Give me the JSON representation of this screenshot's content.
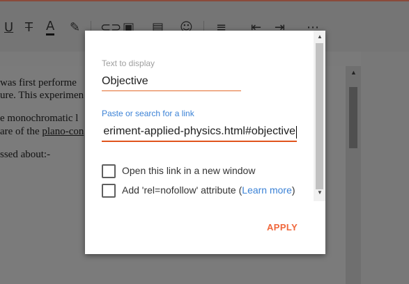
{
  "document": {
    "lines": [
      {
        "pre": "was first performe",
        "u": "",
        "post": ""
      },
      {
        "pre": "ure. This experimen",
        "u": "",
        "post": ""
      },
      {
        "pre": "e monochromatic l",
        "u": "",
        "post": ""
      },
      {
        "pre": "are of the ",
        "u": "plano-con",
        "post": ""
      },
      {
        "pre": "ssed about:-",
        "u": "",
        "post": ""
      }
    ]
  },
  "toolbar": {
    "icons": [
      "underline-icon",
      "strikethrough-icon",
      "text-color-icon",
      "highlight-icon",
      "link-icon",
      "image-icon",
      "video-icon",
      "emoji-icon",
      "align-icon",
      "indent-decrease-icon",
      "indent-increase-icon",
      "more-icon"
    ]
  },
  "link_dialog": {
    "text_label": "Text to display",
    "text_value": "Objective",
    "url_label": "Paste or search for a link",
    "url_value": "eriment-applied-physics.html#objective",
    "new_window_label": "Open this link in a new window",
    "nofollow_label_pre": "Add 'rel=nofollow' attribute (",
    "nofollow_link": "Learn more",
    "nofollow_label_post": ")",
    "apply_label": "APPLY",
    "accent_color": "#e0541d",
    "link_color": "#3b82d6"
  }
}
